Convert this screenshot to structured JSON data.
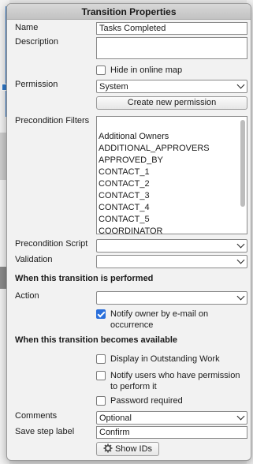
{
  "dialog": {
    "title": "Transition Properties",
    "name_label": "Name",
    "name_value": "Tasks Completed",
    "description_label": "Description",
    "description_value": "",
    "hide_online_map_label": "Hide in online map",
    "permission_label": "Permission",
    "permission_value": "System",
    "create_permission_button": "Create new permission",
    "precondition_filters_label": "Precondition Filters",
    "precondition_filters_items": [
      "Additional Owners",
      "ADDITIONAL_APPROVERS",
      "APPROVED_BY",
      "CONTACT_1",
      "CONTACT_2",
      "CONTACT_3",
      "CONTACT_4",
      "CONTACT_5",
      "COORDINATOR"
    ],
    "precondition_script_label": "Precondition Script",
    "precondition_script_value": "",
    "validation_label": "Validation",
    "validation_value": "",
    "section_performed": "When this transition is performed",
    "action_label": "Action",
    "action_value": "",
    "notify_owner_label": "Notify owner by e-mail on occurrence",
    "notify_owner_checked": true,
    "section_available": "When this transition becomes available",
    "display_outstanding_label": "Display in Outstanding Work",
    "notify_users_label": "Notify users who have permission to perform it",
    "password_required_label": "Password required",
    "comments_label": "Comments",
    "comments_value": "Optional",
    "save_step_label": "Save step label",
    "save_step_value": "Confirm",
    "show_ids_button": "Show IDs"
  },
  "colors": {
    "accent": "#2a6fdb",
    "background_link": "#2f78c9"
  }
}
